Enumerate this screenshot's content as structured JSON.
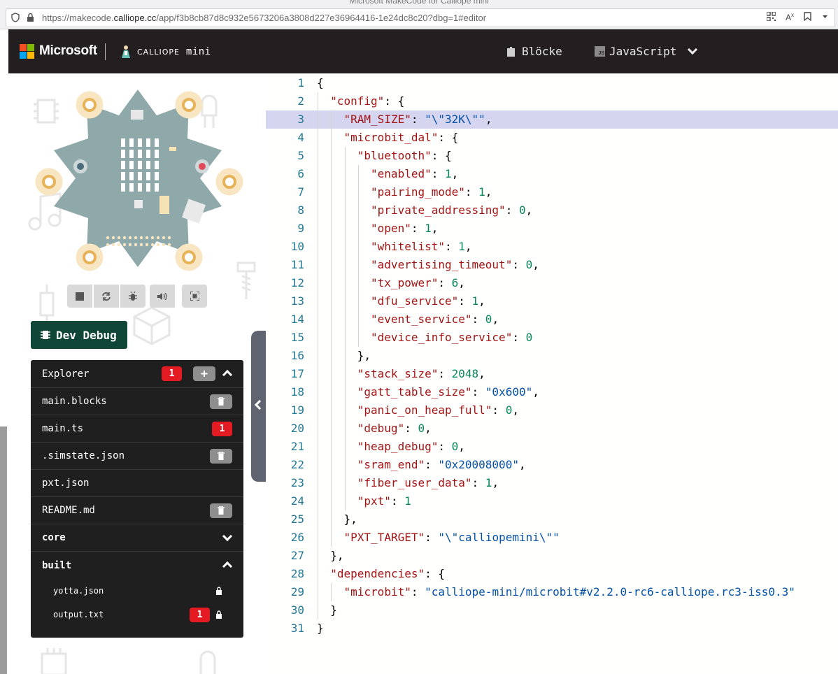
{
  "browser": {
    "window_title": "Microsoft MakeCode for Calliope mini",
    "url_prefix": "https://makecode.",
    "url_host": "calliope.cc",
    "url_path": "/app/f3b8cb87d8c932e5673206a3808d227e36964416-1e24dc8c20?dbg=1#editor"
  },
  "header": {
    "microsoft_label": "Microsoft",
    "brand_small": "CALLIOPE",
    "brand_mini": "mini",
    "blocks_label": "Blöcke",
    "javascript_label": "JavaScript",
    "js_badge": "JS"
  },
  "simulator": {
    "debug_label": "Dev Debug",
    "controls": [
      "stop-icon",
      "restart-icon",
      "debug-icon",
      "mute-icon",
      "fullscreen-icon"
    ]
  },
  "explorer": {
    "title": "Explorer",
    "error_count": "1",
    "files": [
      {
        "name": "main.blocks",
        "action": "trash-icon"
      },
      {
        "name": "main.ts",
        "badge": "1"
      },
      {
        "name": ".simstate.json",
        "action": "trash-icon"
      },
      {
        "name": "pxt.json"
      },
      {
        "name": "README.md",
        "action": "trash-icon"
      }
    ],
    "groups": [
      {
        "name": "core",
        "expanded": false
      },
      {
        "name": "built",
        "expanded": true
      }
    ],
    "built_files": [
      {
        "name": "yotta.json",
        "locked": true
      },
      {
        "name": "output.txt",
        "badge": "1",
        "locked": true
      }
    ]
  },
  "colors": {
    "header_bg": "#231f20",
    "debug_green": "#0f4638",
    "error_red": "#e51b23",
    "active_line": "#d5d5f0",
    "ms_red": "#f25022",
    "ms_green": "#7fba00",
    "ms_blue": "#00a4ef",
    "ms_yellow": "#ffb900"
  },
  "editor": {
    "active_line": 3,
    "lines": [
      {
        "n": "1",
        "indent": 0,
        "tokens": [
          [
            "p",
            "{"
          ]
        ]
      },
      {
        "n": "2",
        "indent": 1,
        "tokens": [
          [
            "k",
            "\"config\""
          ],
          [
            "p",
            ": {"
          ]
        ]
      },
      {
        "n": "3",
        "indent": 2,
        "tokens": [
          [
            "k",
            "\"RAM_SIZE\""
          ],
          [
            "p",
            ": "
          ],
          [
            "s",
            "\"\\\"32K\\\"\""
          ],
          [
            "p",
            ","
          ]
        ]
      },
      {
        "n": "4",
        "indent": 2,
        "tokens": [
          [
            "k",
            "\"microbit_dal\""
          ],
          [
            "p",
            ": {"
          ]
        ]
      },
      {
        "n": "5",
        "indent": 3,
        "tokens": [
          [
            "k",
            "\"bluetooth\""
          ],
          [
            "p",
            ": {"
          ]
        ]
      },
      {
        "n": "6",
        "indent": 4,
        "tokens": [
          [
            "k",
            "\"enabled\""
          ],
          [
            "p",
            ": "
          ],
          [
            "n",
            "1"
          ],
          [
            "p",
            ","
          ]
        ]
      },
      {
        "n": "7",
        "indent": 4,
        "tokens": [
          [
            "k",
            "\"pairing_mode\""
          ],
          [
            "p",
            ": "
          ],
          [
            "n",
            "1"
          ],
          [
            "p",
            ","
          ]
        ]
      },
      {
        "n": "8",
        "indent": 4,
        "tokens": [
          [
            "k",
            "\"private_addressing\""
          ],
          [
            "p",
            ": "
          ],
          [
            "n",
            "0"
          ],
          [
            "p",
            ","
          ]
        ]
      },
      {
        "n": "9",
        "indent": 4,
        "tokens": [
          [
            "k",
            "\"open\""
          ],
          [
            "p",
            ": "
          ],
          [
            "n",
            "1"
          ],
          [
            "p",
            ","
          ]
        ]
      },
      {
        "n": "10",
        "indent": 4,
        "tokens": [
          [
            "k",
            "\"whitelist\""
          ],
          [
            "p",
            ": "
          ],
          [
            "n",
            "1"
          ],
          [
            "p",
            ","
          ]
        ]
      },
      {
        "n": "11",
        "indent": 4,
        "tokens": [
          [
            "k",
            "\"advertising_timeout\""
          ],
          [
            "p",
            ": "
          ],
          [
            "n",
            "0"
          ],
          [
            "p",
            ","
          ]
        ]
      },
      {
        "n": "12",
        "indent": 4,
        "tokens": [
          [
            "k",
            "\"tx_power\""
          ],
          [
            "p",
            ": "
          ],
          [
            "n",
            "6"
          ],
          [
            "p",
            ","
          ]
        ]
      },
      {
        "n": "13",
        "indent": 4,
        "tokens": [
          [
            "k",
            "\"dfu_service\""
          ],
          [
            "p",
            ": "
          ],
          [
            "n",
            "1"
          ],
          [
            "p",
            ","
          ]
        ]
      },
      {
        "n": "14",
        "indent": 4,
        "tokens": [
          [
            "k",
            "\"event_service\""
          ],
          [
            "p",
            ": "
          ],
          [
            "n",
            "0"
          ],
          [
            "p",
            ","
          ]
        ]
      },
      {
        "n": "15",
        "indent": 4,
        "tokens": [
          [
            "k",
            "\"device_info_service\""
          ],
          [
            "p",
            ": "
          ],
          [
            "n",
            "0"
          ]
        ]
      },
      {
        "n": "16",
        "indent": 3,
        "tokens": [
          [
            "p",
            "},"
          ]
        ]
      },
      {
        "n": "17",
        "indent": 3,
        "tokens": [
          [
            "k",
            "\"stack_size\""
          ],
          [
            "p",
            ": "
          ],
          [
            "n",
            "2048"
          ],
          [
            "p",
            ","
          ]
        ]
      },
      {
        "n": "18",
        "indent": 3,
        "tokens": [
          [
            "k",
            "\"gatt_table_size\""
          ],
          [
            "p",
            ": "
          ],
          [
            "s",
            "\"0x600\""
          ],
          [
            "p",
            ","
          ]
        ]
      },
      {
        "n": "19",
        "indent": 3,
        "tokens": [
          [
            "k",
            "\"panic_on_heap_full\""
          ],
          [
            "p",
            ": "
          ],
          [
            "n",
            "0"
          ],
          [
            "p",
            ","
          ]
        ]
      },
      {
        "n": "20",
        "indent": 3,
        "tokens": [
          [
            "k",
            "\"debug\""
          ],
          [
            "p",
            ": "
          ],
          [
            "n",
            "0"
          ],
          [
            "p",
            ","
          ]
        ]
      },
      {
        "n": "21",
        "indent": 3,
        "tokens": [
          [
            "k",
            "\"heap_debug\""
          ],
          [
            "p",
            ": "
          ],
          [
            "n",
            "0"
          ],
          [
            "p",
            ","
          ]
        ]
      },
      {
        "n": "22",
        "indent": 3,
        "tokens": [
          [
            "k",
            "\"sram_end\""
          ],
          [
            "p",
            ": "
          ],
          [
            "s",
            "\"0x20008000\""
          ],
          [
            "p",
            ","
          ]
        ]
      },
      {
        "n": "23",
        "indent": 3,
        "tokens": [
          [
            "k",
            "\"fiber_user_data\""
          ],
          [
            "p",
            ": "
          ],
          [
            "n",
            "1"
          ],
          [
            "p",
            ","
          ]
        ]
      },
      {
        "n": "24",
        "indent": 3,
        "tokens": [
          [
            "k",
            "\"pxt\""
          ],
          [
            "p",
            ": "
          ],
          [
            "n",
            "1"
          ]
        ]
      },
      {
        "n": "25",
        "indent": 2,
        "tokens": [
          [
            "p",
            "},"
          ]
        ]
      },
      {
        "n": "26",
        "indent": 2,
        "tokens": [
          [
            "k",
            "\"PXT_TARGET\""
          ],
          [
            "p",
            ": "
          ],
          [
            "s",
            "\"\\\"calliopemini\\\"\""
          ]
        ]
      },
      {
        "n": "27",
        "indent": 1,
        "tokens": [
          [
            "p",
            "},"
          ]
        ]
      },
      {
        "n": "28",
        "indent": 1,
        "tokens": [
          [
            "k",
            "\"dependencies\""
          ],
          [
            "p",
            ": {"
          ]
        ]
      },
      {
        "n": "29",
        "indent": 2,
        "tokens": [
          [
            "k",
            "\"microbit\""
          ],
          [
            "p",
            ": "
          ],
          [
            "s",
            "\"calliope-mini/microbit#v2.2.0-rc6-calliope.rc3-iss0.3\""
          ]
        ]
      },
      {
        "n": "30",
        "indent": 1,
        "tokens": [
          [
            "p",
            "}"
          ]
        ]
      },
      {
        "n": "31",
        "indent": 0,
        "tokens": [
          [
            "p",
            "}"
          ]
        ]
      }
    ]
  }
}
